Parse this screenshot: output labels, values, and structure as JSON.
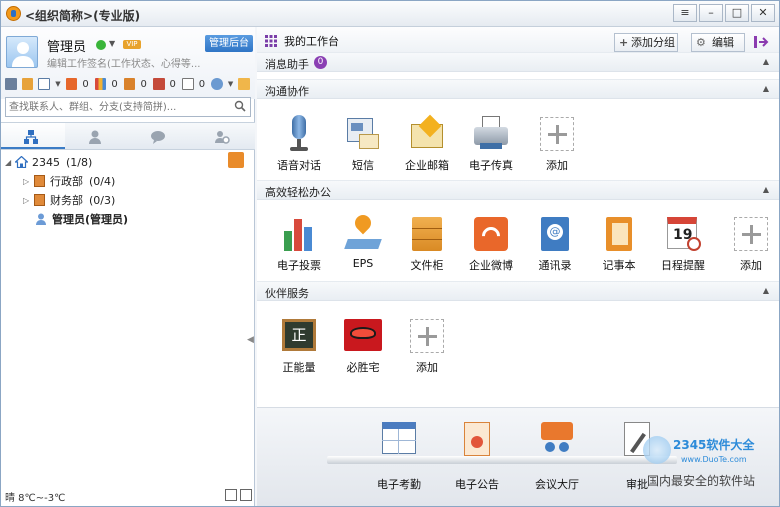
{
  "window": {
    "title": "<组织简称>(专业版)"
  },
  "profile": {
    "name": "管理员",
    "signature": "编辑工作签名(工作状态、心得等...",
    "admin_button": "管理后台"
  },
  "quickbar": {
    "counts": [
      "0",
      "0",
      "0",
      "0",
      "0"
    ]
  },
  "search": {
    "placeholder": "查找联系人、群组、分支(支持简拼)..."
  },
  "tree": {
    "root": {
      "label": "2345",
      "count": "(1/8)"
    },
    "departments": [
      {
        "label": "行政部",
        "count": "(0/4)"
      },
      {
        "label": "财务部",
        "count": "(0/3)"
      }
    ],
    "user": {
      "label": "管理员(管理员)"
    }
  },
  "weather": "晴 8℃~-3℃",
  "workspace": {
    "title": "我的工作台",
    "add_group": "添加分组",
    "edit": "编辑"
  },
  "sections": {
    "messages": {
      "title": "消息助手",
      "badge": "0"
    },
    "comm": {
      "title": "沟通协作",
      "apps": [
        "语音对话",
        "短信",
        "企业邮箱",
        "电子传真"
      ],
      "add": "添加"
    },
    "office": {
      "title": "高效轻松办公",
      "apps": [
        "电子投票",
        "EPS",
        "文件柜",
        "企业微博",
        "通讯录",
        "记事本",
        "日程提醒"
      ],
      "add": "添加"
    },
    "partner": {
      "title": "伙伴服务",
      "apps": [
        "正能量",
        "必胜宅"
      ],
      "add": "添加"
    }
  },
  "dock": {
    "apps": [
      "电子考勤",
      "电子公告",
      "会议大厅",
      "审批"
    ]
  },
  "watermark": {
    "brand": "2345软件大全",
    "url": "www.DuoTe.com",
    "slogan": "国内最安全的软件站"
  }
}
